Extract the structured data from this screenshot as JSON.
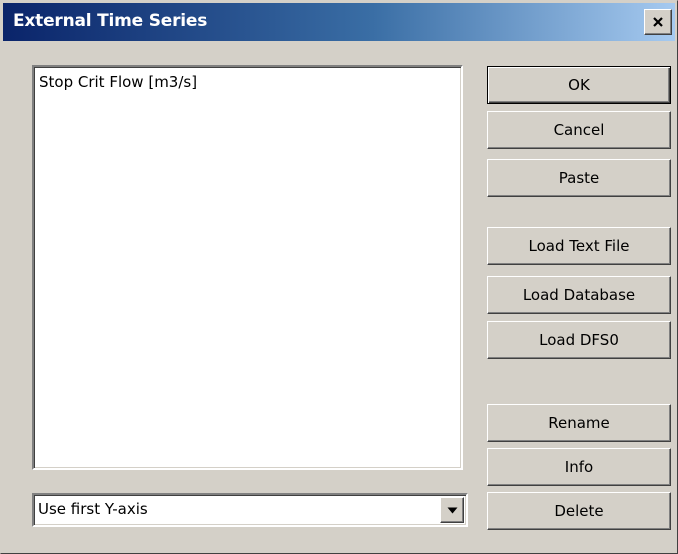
{
  "window": {
    "title": "External Time Series",
    "close_icon": "close-icon"
  },
  "timeseries_list": {
    "items": [
      "Stop Crit Flow [m3/s]"
    ]
  },
  "axis_select": {
    "value": "Use first Y-axis",
    "arrow_icon": "chevron-down-icon"
  },
  "buttons": {
    "ok": "OK",
    "cancel": "Cancel",
    "paste": "Paste",
    "load_text_file": "Load Text File",
    "load_database": "Load Database",
    "load_dfs0": "Load DFS0",
    "rename": "Rename",
    "info": "Info",
    "delete": "Delete"
  },
  "colors": {
    "face": "#d4d0c8",
    "title_start": "#0a246a",
    "title_end": "#a6caf0"
  }
}
